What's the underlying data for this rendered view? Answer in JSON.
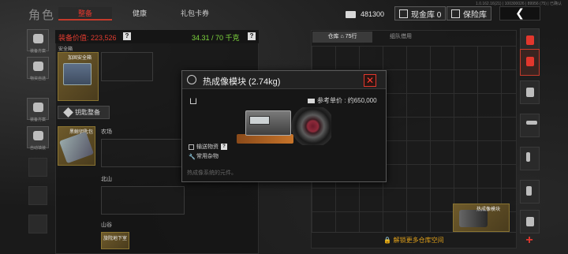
{
  "version": "1.0.162.16(21) | 100300026 | 89956 (75) | 已确认",
  "header": {
    "title": "角色",
    "tabs": [
      {
        "label": "整备",
        "active": true
      },
      {
        "label": "健康",
        "active": false
      },
      {
        "label": "礼包卡券",
        "active": false
      }
    ],
    "money": "481300",
    "cash_vault_label": "现金库 0",
    "safe_label": "保险库",
    "back_label": "❮"
  },
  "left_sidebar": [
    {
      "label": "装备方案"
    },
    {
      "label": "物资自选"
    },
    {
      "label": "装备方案"
    },
    {
      "label": "自动填装"
    }
  ],
  "loadout": {
    "value_label": "装备价值: 223,526",
    "value_help": "?",
    "weight": "34.31 / 70 千克",
    "weight_help": "?",
    "secure_case_header": "安全箱",
    "secure_case_label": "加固安全箱",
    "keys_button": "钥匙整备",
    "key_item_label": "黑鲸钥匙包",
    "maps": [
      "农场",
      "北山",
      "山谷"
    ],
    "bottom_item_label": "旅院地下室"
  },
  "warehouse": {
    "tab_storage": "仓库",
    "tab_storage_count": "75行",
    "tab_team": "组队借用",
    "unlock_label": "🔒 解锁更多仓库空间",
    "item_label": "热成像模块",
    "add_icon": "+"
  },
  "popup": {
    "title": "热成像模块 (2.74kg)",
    "close": "✕",
    "ref_price": "参考单价 : 约650,000",
    "tag1": "输送物资",
    "tag1_help": "?",
    "tag2": "常用杂物",
    "description": "热成像系统的元件。"
  },
  "colors": {
    "accent_red": "#e2372d",
    "weight_green": "#7fd73e",
    "unlock_gold": "#e0a01a",
    "item_gold": "#8a7431"
  }
}
